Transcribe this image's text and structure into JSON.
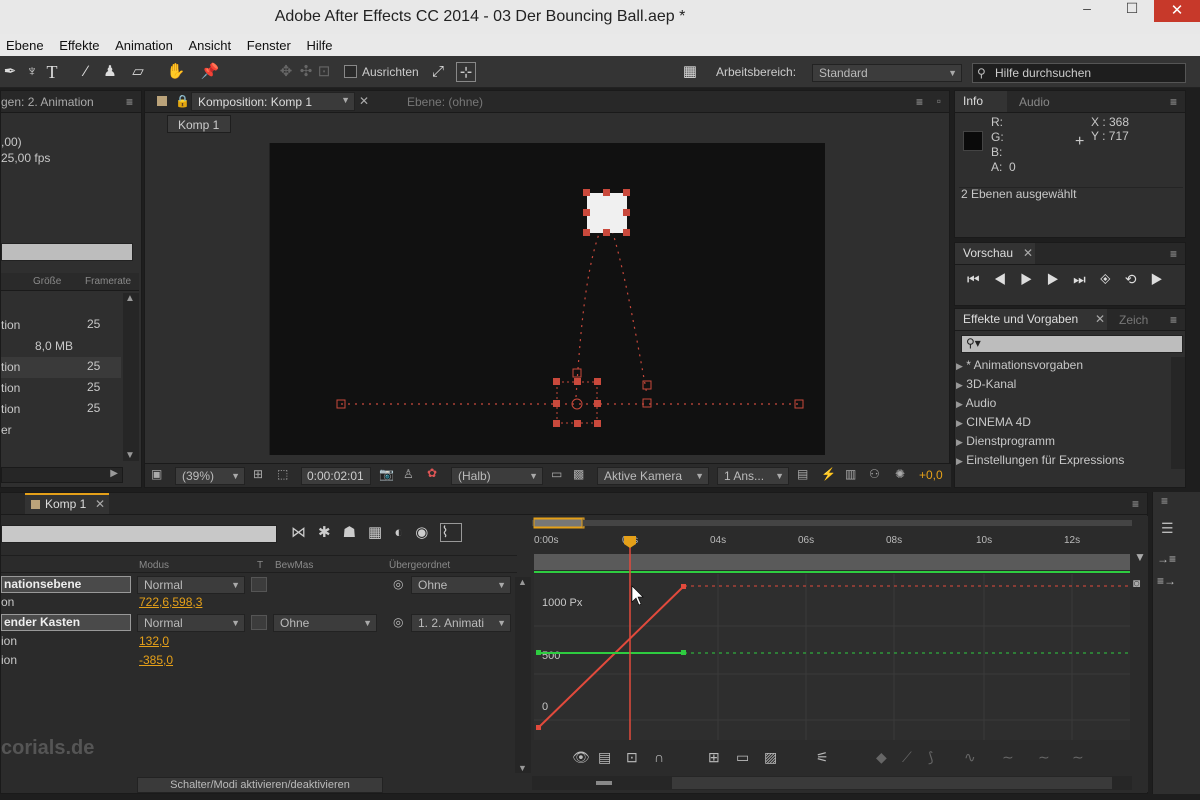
{
  "window": {
    "title": "Adobe After Effects CC 2014 - 03 Der Bouncing Ball.aep *",
    "min": "–",
    "max": "☐",
    "close": "✕"
  },
  "menu": [
    "Ebene",
    "Effekte",
    "Animation",
    "Ansicht",
    "Fenster",
    "Hilfe"
  ],
  "toolbar": {
    "align_label": "Ausrichten",
    "workspace_label": "Arbeitsbereich:",
    "workspace_value": "Standard",
    "search_placeholder": "Hilfe durchsuchen"
  },
  "project": {
    "tab": "gen: 2. Animation",
    "info1": ",00)",
    "info2": "25,00 fps",
    "cols": [
      "Größe",
      "Framerate"
    ],
    "rows": [
      {
        "name": "tion",
        "size": "",
        "fps": "25"
      },
      {
        "name": "",
        "size": "8,0 MB",
        "fps": ""
      },
      {
        "name": "tion",
        "size": "",
        "fps": "25"
      },
      {
        "name": "tion",
        "size": "",
        "fps": "25"
      },
      {
        "name": "tion",
        "size": "",
        "fps": "25"
      },
      {
        "name": "er",
        "size": "",
        "fps": ""
      }
    ]
  },
  "comp": {
    "tab": "Komposition: Komp 1",
    "layer_tab": "Ebene: (ohne)",
    "subtab": "Komp 1",
    "zoom": "(39%)",
    "timecode": "0:00:02:01",
    "resolution": "(Halb)",
    "camera": "Aktive Kamera",
    "views": "1 Ans...",
    "exposure": "+0,0"
  },
  "info": {
    "tab1": "Info",
    "tab2": "Audio",
    "r": "R:",
    "g": "G:",
    "b": "B:",
    "a": "A:",
    "a_val": "0",
    "x": "X : 368",
    "y": "Y : 717",
    "status": "2 Ebenen ausgewählt"
  },
  "preview": {
    "tab": "Vorschau"
  },
  "effects": {
    "tab": "Effekte und Vorgaben",
    "tab2": "Zeich",
    "items": [
      "* Animationsvorgaben",
      "3D-Kanal",
      "Audio",
      "CINEMA 4D",
      "Dienstprogramm",
      "Einstellungen für Expressions"
    ]
  },
  "timeline": {
    "tab": "Komp 1",
    "cols": {
      "mode": "Modus",
      "t": "T",
      "trkmat": "BewMas",
      "parent": "Übergeordnet"
    },
    "layers": [
      {
        "name": "nationsebene",
        "mode": "Normal",
        "trk": "",
        "parent": "Ohne",
        "prop": "on",
        "val": "722,6,598,3"
      },
      {
        "name": "ender Kasten",
        "mode": "Normal",
        "trk": "Ohne",
        "parent": "1. 2. Animati",
        "prop": "ion",
        "val": "132,0"
      },
      {
        "name": "",
        "mode": "",
        "trk": "",
        "parent": "",
        "prop": "ion",
        "val": "-385,0"
      }
    ],
    "toggle": "Schalter/Modi aktivieren/deaktivieren",
    "ruler": [
      "0:00s",
      "02s",
      "04s",
      "06s",
      "08s",
      "10s",
      "12s"
    ],
    "graph_labels": [
      "1000 Px",
      "500",
      "0"
    ],
    "watermark": "corials.de"
  },
  "colors": {
    "accent": "#e5a019",
    "red_curve": "#e24a3c",
    "green_curve": "#2ecc40",
    "motion_path": "#c9493c"
  }
}
